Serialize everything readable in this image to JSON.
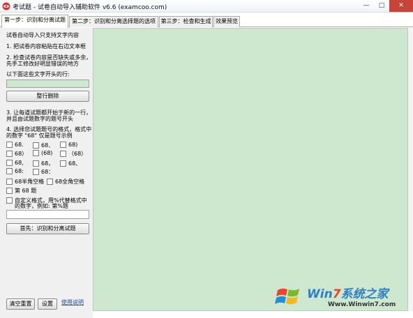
{
  "window": {
    "title": "考试题 - 试卷自动导入辅助软件 v6.6 (examcoo.com)",
    "minimize_glyph": "—",
    "maximize_glyph": "□",
    "close_glyph": "✕"
  },
  "tabs": [
    {
      "label": "第一步：识别和分离试题"
    },
    {
      "label": "第二步：识别和分离选择题的选项"
    },
    {
      "label": "第三步：检查和生成"
    },
    {
      "label": "效果预览"
    }
  ],
  "step1": {
    "note": "试卷自动导入只支持文字内容",
    "instr1": "1. 把试卷内容粘贴在右边文本框",
    "instr2_line1": "2. 检查试卷内容是否缺失或多余，",
    "instr2_line2": "先手工修改好明显错误的地方",
    "delete_label": "以下面这些文字开头的行:",
    "delete_input_value": "",
    "delete_button": "整行删除",
    "instr3_line1": "3. 让每道试题都开始于新的一行，",
    "instr3_line2": "并且由试题数字的题号开头",
    "instr4_line1": "4. 选择您试题题号的格式，格式中",
    "instr4_line2": "的数字 \"68\" 仅是题号示例",
    "formats": [
      [
        "68.",
        "68．",
        "68)"
      ],
      [
        "68）",
        "(68)",
        "（68）"
      ],
      [
        "68,",
        "68，",
        "68、"
      ],
      [
        "68:",
        "68："
      ]
    ],
    "half_space": "68半角空格",
    "full_space": "68全角空格",
    "di_ti": "第 68 题",
    "custom_line1": "自定义格式，用%代替格式中",
    "custom_line2": "的数字，例如: 第%题",
    "custom_input_value": "",
    "first_button": "首先：识别和分离试题",
    "clear_button": "清空重置",
    "settings_button": "设置",
    "help_link": "使用说明"
  },
  "editor": {
    "content": "",
    "background": "#cde8cf"
  },
  "watermark": {
    "brand_win": "Win",
    "brand_seven": "7",
    "brand_cn": "系统之家",
    "url": "Www.Winwin7.com"
  }
}
